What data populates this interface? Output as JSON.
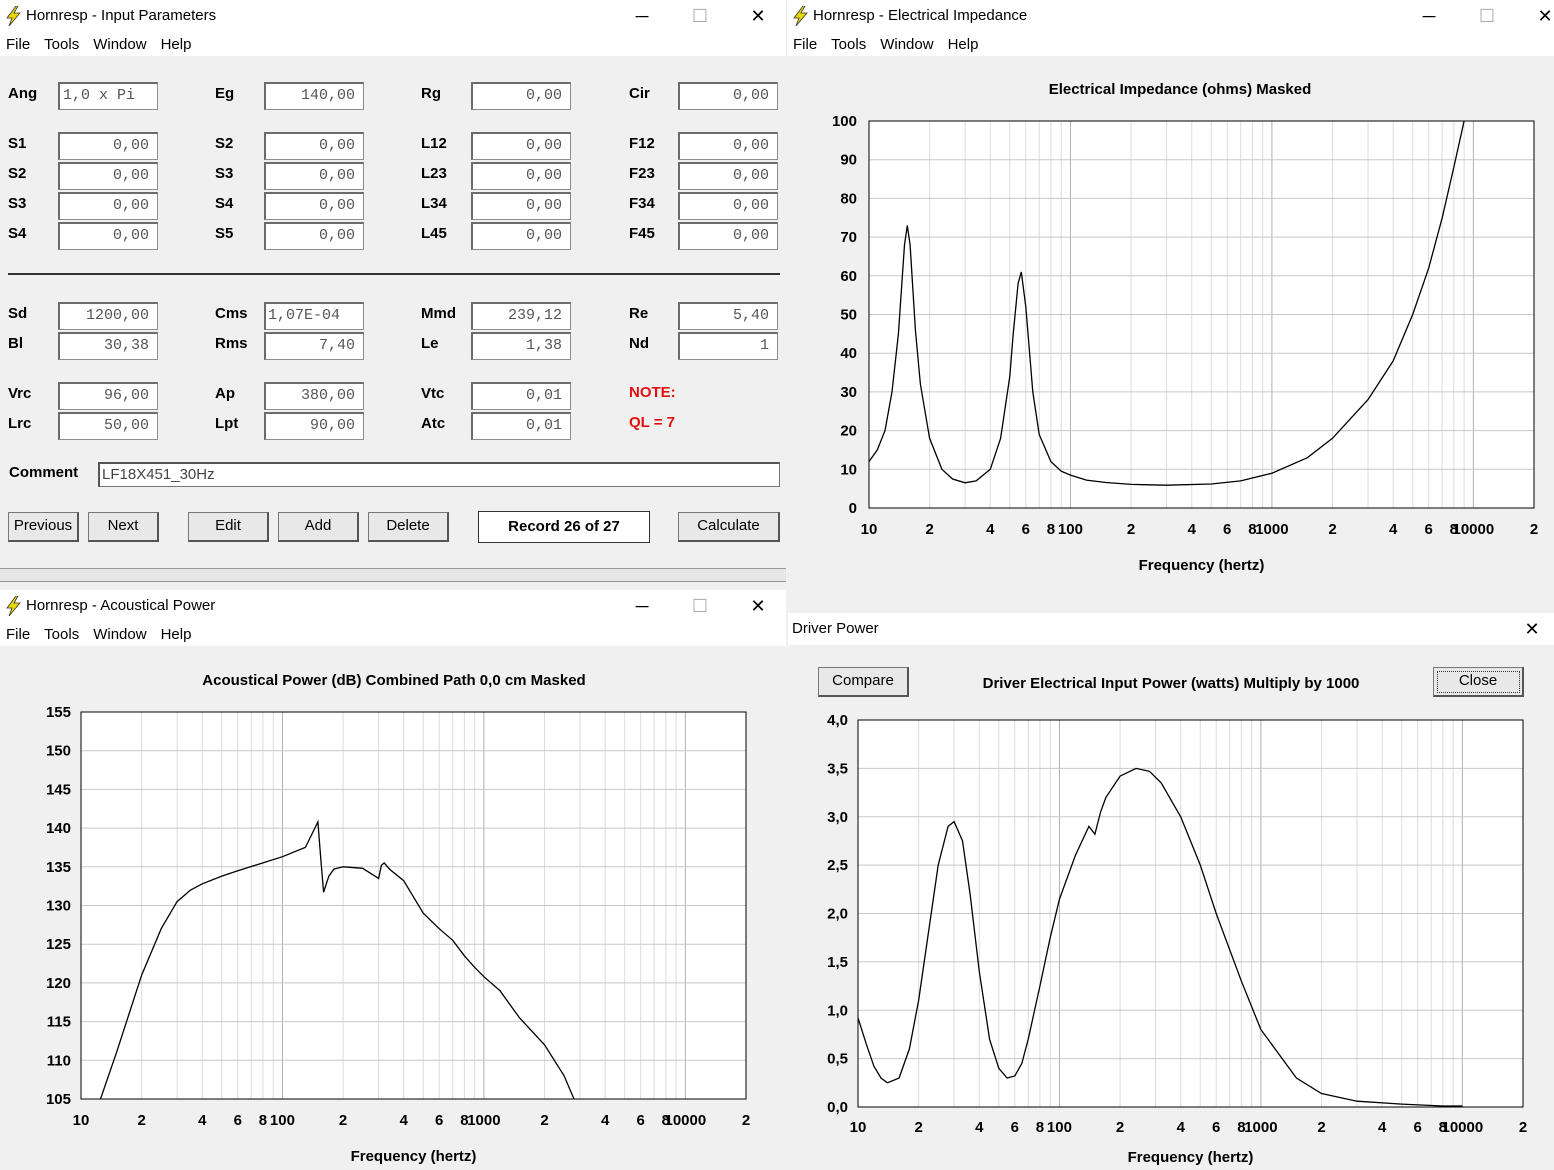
{
  "menu": [
    "File",
    "Tools",
    "Window",
    "Help"
  ],
  "icons": {
    "app": "lightning-bolt-icon",
    "minimize": "minimize-icon",
    "maximize": "maximize-icon",
    "close": "close-icon"
  },
  "colors": {
    "note": "#e31010",
    "titlebar": "#ffffff",
    "window_bg": "#f0f0f0",
    "icon_yellow": "#e8d800"
  },
  "input_window": {
    "title": "Hornresp - Input Parameters",
    "rows": [
      [
        {
          "label": "Ang",
          "value": "1,0 x Pi"
        },
        {
          "label": "Eg",
          "value": "140,00"
        },
        {
          "label": "Rg",
          "value": "0,00"
        },
        {
          "label": "Cir",
          "value": "0,00"
        }
      ],
      [
        {
          "label": "S1",
          "value": "0,00"
        },
        {
          "label": "S2",
          "value": "0,00"
        },
        {
          "label": "L12",
          "value": "0,00"
        },
        {
          "label": "F12",
          "value": "0,00"
        }
      ],
      [
        {
          "label": "S2",
          "value": "0,00"
        },
        {
          "label": "S3",
          "value": "0,00"
        },
        {
          "label": "L23",
          "value": "0,00"
        },
        {
          "label": "F23",
          "value": "0,00"
        }
      ],
      [
        {
          "label": "S3",
          "value": "0,00"
        },
        {
          "label": "S4",
          "value": "0,00"
        },
        {
          "label": "L34",
          "value": "0,00"
        },
        {
          "label": "F34",
          "value": "0,00"
        }
      ],
      [
        {
          "label": "S4",
          "value": "0,00"
        },
        {
          "label": "S5",
          "value": "0,00"
        },
        {
          "label": "L45",
          "value": "0,00"
        },
        {
          "label": "F45",
          "value": "0,00"
        }
      ],
      [
        {
          "label": "Sd",
          "value": "1200,00"
        },
        {
          "label": "Cms",
          "value": "1,07E-04"
        },
        {
          "label": "Mmd",
          "value": "239,12"
        },
        {
          "label": "Re",
          "value": "5,40"
        }
      ],
      [
        {
          "label": "Bl",
          "value": "30,38"
        },
        {
          "label": "Rms",
          "value": "7,40"
        },
        {
          "label": "Le",
          "value": "1,38"
        },
        {
          "label": "Nd",
          "value": "1"
        }
      ],
      [
        {
          "label": "Vrc",
          "value": "96,00"
        },
        {
          "label": "Ap",
          "value": "380,00"
        },
        {
          "label": "Vtc",
          "value": "0,01"
        }
      ],
      [
        {
          "label": "Lrc",
          "value": "50,00"
        },
        {
          "label": "Lpt",
          "value": "90,00"
        },
        {
          "label": "Atc",
          "value": "0,01"
        }
      ]
    ],
    "note_line1": "NOTE:",
    "note_line2": "QL = 7",
    "comment_label": "Comment",
    "comment_value": "LF18X451_30Hz",
    "buttons": {
      "previous": "Previous",
      "next": "Next",
      "edit": "Edit",
      "add": "Add",
      "delete": "Delete",
      "calculate": "Calculate"
    },
    "record": "Record 26 of 27"
  },
  "impedance_window": {
    "title": "Hornresp - Electrical Impedance"
  },
  "acoustic_window": {
    "title": "Hornresp - Acoustical Power"
  },
  "driver_window": {
    "title": "Driver Power",
    "compare_label": "Compare",
    "close_label": "Close"
  },
  "chart_data": [
    {
      "id": "impedance",
      "type": "line",
      "title": "Electrical Impedance (ohms)   Masked",
      "xlabel": "Frequency (hertz)",
      "ylabel": "",
      "xscale": "log",
      "xlim": [
        10,
        20000
      ],
      "ylim": [
        0,
        100
      ],
      "yticks": [
        0,
        10,
        20,
        30,
        40,
        50,
        60,
        70,
        80,
        90,
        100
      ],
      "ytick_labels": [
        "0",
        "10",
        "20",
        "30",
        "40",
        "50",
        "60",
        "70",
        "80",
        "90",
        "100"
      ],
      "xticks": [
        10,
        20,
        40,
        60,
        80,
        100,
        200,
        400,
        600,
        800,
        1000,
        2000,
        4000,
        6000,
        8000,
        10000,
        20000
      ],
      "xtick_labels": [
        "10",
        "2",
        "4",
        "6",
        "8",
        "100",
        "2",
        "4",
        "6",
        "8",
        "1000",
        "2",
        "4",
        "6",
        "8",
        "10000",
        "2"
      ],
      "grid": true,
      "series": [
        {
          "x": [
            10,
            11,
            12,
            13,
            14,
            15,
            15.5,
            16,
            17,
            18,
            20,
            23,
            26,
            30,
            34,
            40,
            45,
            50,
            52,
            55,
            57,
            60,
            65,
            70,
            80,
            90,
            100,
            120,
            150,
            200,
            300,
            500,
            700,
            1000,
            1500,
            2000,
            3000,
            4000,
            5000,
            6000,
            7000,
            8000,
            9000
          ],
          "y": [
            12,
            15,
            20,
            30,
            45,
            68,
            73,
            68,
            46,
            32,
            18,
            10,
            7.5,
            6.5,
            7,
            10,
            18,
            34,
            45,
            58,
            61,
            52,
            30,
            19,
            12,
            9.5,
            8.5,
            7.2,
            6.6,
            6.1,
            5.9,
            6.2,
            7,
            9,
            13,
            18,
            28,
            38,
            50,
            62,
            75,
            88,
            100
          ]
        }
      ]
    },
    {
      "id": "acoustical-power",
      "type": "line",
      "title": "Acoustical Power (dB)   Combined   Path 0,0 cm   Masked",
      "xlabel": "Frequency (hertz)",
      "ylabel": "",
      "xscale": "log",
      "xlim": [
        10,
        20000
      ],
      "ylim": [
        105,
        155
      ],
      "yticks": [
        105,
        110,
        115,
        120,
        125,
        130,
        135,
        140,
        145,
        150,
        155
      ],
      "ytick_labels": [
        "105",
        "110",
        "115",
        "120",
        "125",
        "130",
        "135",
        "140",
        "145",
        "150",
        "155"
      ],
      "xticks": [
        10,
        20,
        40,
        60,
        80,
        100,
        200,
        400,
        600,
        800,
        1000,
        2000,
        4000,
        6000,
        8000,
        10000,
        20000
      ],
      "xtick_labels": [
        "10",
        "2",
        "4",
        "6",
        "8",
        "100",
        "2",
        "4",
        "6",
        "8",
        "1000",
        "2",
        "4",
        "6",
        "8",
        "10000",
        "2"
      ],
      "grid": true,
      "series": [
        {
          "x": [
            12.5,
            15,
            20,
            25,
            30,
            35,
            40,
            50,
            60,
            80,
            100,
            130,
            150,
            155,
            160,
            165,
            170,
            180,
            200,
            250,
            300,
            310,
            320,
            340,
            400,
            450,
            500,
            600,
            700,
            800,
            900,
            1000,
            1200,
            1500,
            2000,
            2500,
            2800
          ],
          "y": [
            105,
            111,
            121,
            127,
            130.5,
            132,
            132.8,
            133.8,
            134.5,
            135.5,
            136.3,
            137.5,
            140.8,
            136,
            131.7,
            132.8,
            133.8,
            134.7,
            135,
            134.8,
            133.5,
            135.2,
            135.5,
            134.7,
            133.2,
            131,
            129,
            127,
            125.5,
            123.5,
            122,
            120.8,
            119,
            115.5,
            112,
            108,
            105
          ]
        }
      ]
    },
    {
      "id": "driver-power",
      "type": "line",
      "title": "Driver Electrical Input Power (watts)   Multiply by 1000",
      "xlabel": "Frequency (hertz)",
      "ylabel": "",
      "xscale": "log",
      "xlim": [
        10,
        20000
      ],
      "ylim": [
        0,
        4
      ],
      "yticks": [
        0,
        0.5,
        1,
        1.5,
        2,
        2.5,
        3,
        3.5,
        4
      ],
      "ytick_labels": [
        "0,0",
        "0,5",
        "1,0",
        "1,5",
        "2,0",
        "2,5",
        "3,0",
        "3,5",
        "4,0"
      ],
      "xticks": [
        10,
        20,
        40,
        60,
        80,
        100,
        200,
        400,
        600,
        800,
        1000,
        2000,
        4000,
        6000,
        8000,
        10000,
        20000
      ],
      "xtick_labels": [
        "10",
        "2",
        "4",
        "6",
        "8",
        "100",
        "2",
        "4",
        "6",
        "8",
        "1000",
        "2",
        "4",
        "6",
        "8",
        "10000",
        "2"
      ],
      "grid": true,
      "series": [
        {
          "x": [
            10,
            11,
            12,
            13,
            14,
            16,
            18,
            20,
            22,
            25,
            28,
            30,
            33,
            36,
            40,
            45,
            50,
            55,
            60,
            65,
            70,
            80,
            90,
            100,
            120,
            140,
            150,
            160,
            170,
            200,
            240,
            280,
            320,
            400,
            500,
            600,
            800,
            1000,
            1500,
            2000,
            3000,
            5000,
            8000,
            10000
          ],
          "y": [
            0.92,
            0.65,
            0.42,
            0.3,
            0.25,
            0.3,
            0.6,
            1.1,
            1.7,
            2.5,
            2.9,
            2.95,
            2.75,
            2.2,
            1.4,
            0.7,
            0.4,
            0.3,
            0.32,
            0.45,
            0.7,
            1.25,
            1.75,
            2.15,
            2.6,
            2.9,
            2.82,
            3.05,
            3.2,
            3.42,
            3.5,
            3.47,
            3.35,
            3.0,
            2.5,
            2.0,
            1.3,
            0.8,
            0.3,
            0.14,
            0.06,
            0.03,
            0.01,
            0.01
          ]
        }
      ]
    }
  ]
}
